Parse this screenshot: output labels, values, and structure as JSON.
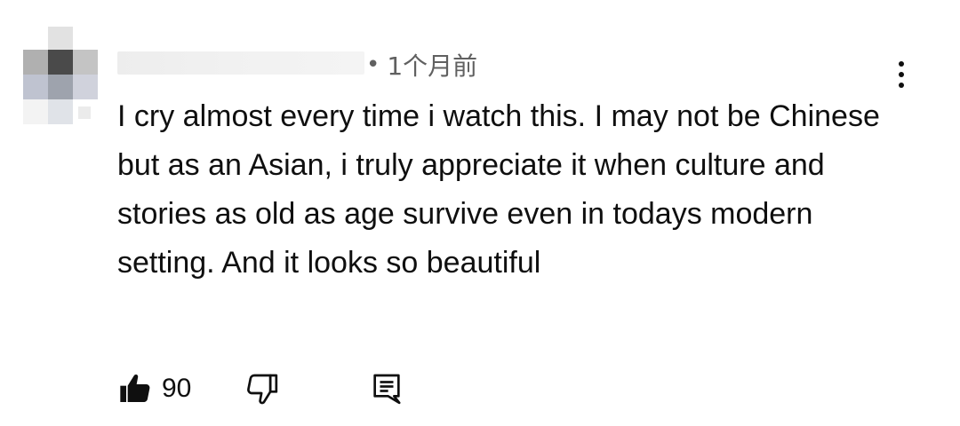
{
  "comment": {
    "timestamp": "1个月前",
    "separator": "•",
    "text": "I cry almost every time i watch this. I may not be Chinese but as an Asian, i truly appreciate it when culture and stories as old as age survive even in todays modern setting. And it looks so beautiful",
    "like_count": "90"
  },
  "icons": {
    "like": "thumbs-up-filled-icon",
    "dislike": "thumbs-down-outline-icon",
    "reply": "comment-reply-icon",
    "menu": "more-vertical-icon"
  },
  "colors": {
    "text": "#0f0f0f",
    "meta": "#606060"
  }
}
